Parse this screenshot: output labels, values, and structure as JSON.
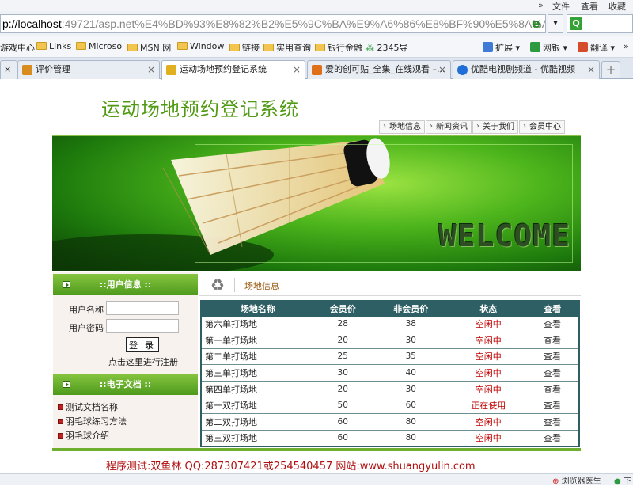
{
  "browser": {
    "menu": [
      "文件",
      "查看",
      "收藏"
    ],
    "menu_arrows": "»",
    "address_host": "p://localhost",
    "address_rest": ":49721/asp.net%E4%BD%93%E8%82%B2%E5%9C%BA%E9%A6%86%E8%BF%90%E5%8A%A8%",
    "address_drop": "▾",
    "search_icon_letter": "Q",
    "favorites": [
      "游戏中心",
      "Links",
      "Microso",
      "MSN 网",
      "Window",
      "链接",
      "实用查询",
      "银行金融",
      "2345导"
    ],
    "tools": [
      {
        "label": "扩展",
        "color": "#3f7bd6"
      },
      {
        "label": "网银",
        "color": "#2c9a3e"
      },
      {
        "label": "翻译",
        "color": "#d64b2a"
      }
    ],
    "tools_more": "»",
    "tabs": [
      {
        "label": "评价管理",
        "icon_color": "#d98c1e",
        "active": false
      },
      {
        "label": "运动场地预约登记系统",
        "icon_color": "#e0b020",
        "active": true
      },
      {
        "label": "爱的创可贴_全集_在线观看 –...",
        "icon_color": "#e07018",
        "active": false
      },
      {
        "label": "优酷电视剧频道 - 优酷视频",
        "icon_color": "#1f6fd6",
        "active": false
      }
    ],
    "tab_close": "×",
    "new_tab": "+",
    "status_items": [
      "浏览器医生",
      "下"
    ]
  },
  "header": {
    "title": "运动场地预约登记系统",
    "nav": [
      "场地信息",
      "新闻资讯",
      "关于我们",
      "会员中心"
    ],
    "banner_text": "WELCOME"
  },
  "sidebar": {
    "user_section": "::用户信息 ::",
    "username_label": "用户名称",
    "password_label": "用户密码",
    "login_button": "登 录",
    "register_link": "点击这里进行注册",
    "docs_section": "::电子文档 ::",
    "docs": [
      "测试文档名称",
      "羽毛球练习方法",
      "羽毛球介绍"
    ]
  },
  "main": {
    "breadcrumb": "场地信息",
    "columns": [
      "场地名称",
      "会员价",
      "非会员价",
      "状态",
      "查看"
    ],
    "rows": [
      {
        "name": "第六单打场地",
        "member": "28",
        "nonmember": "38",
        "status": "空闲中",
        "view": "查看"
      },
      {
        "name": "第一单打场地",
        "member": "20",
        "nonmember": "30",
        "status": "空闲中",
        "view": "查看"
      },
      {
        "name": "第二单打场地",
        "member": "25",
        "nonmember": "35",
        "status": "空闲中",
        "view": "查看"
      },
      {
        "name": "第三单打场地",
        "member": "30",
        "nonmember": "40",
        "status": "空闲中",
        "view": "查看"
      },
      {
        "name": "第四单打场地",
        "member": "20",
        "nonmember": "30",
        "status": "空闲中",
        "view": "查看"
      },
      {
        "name": "第一双打场地",
        "member": "50",
        "nonmember": "60",
        "status": "正在使用",
        "view": "查看"
      },
      {
        "name": "第二双打场地",
        "member": "60",
        "nonmember": "80",
        "status": "空闲中",
        "view": "查看"
      },
      {
        "name": "第三双打场地",
        "member": "60",
        "nonmember": "80",
        "status": "空闲中",
        "view": "查看"
      }
    ]
  },
  "footer": {
    "text": "程序测试:双鱼林  QQ:287307421或254540457 网站:www.shuangyulin.com"
  }
}
